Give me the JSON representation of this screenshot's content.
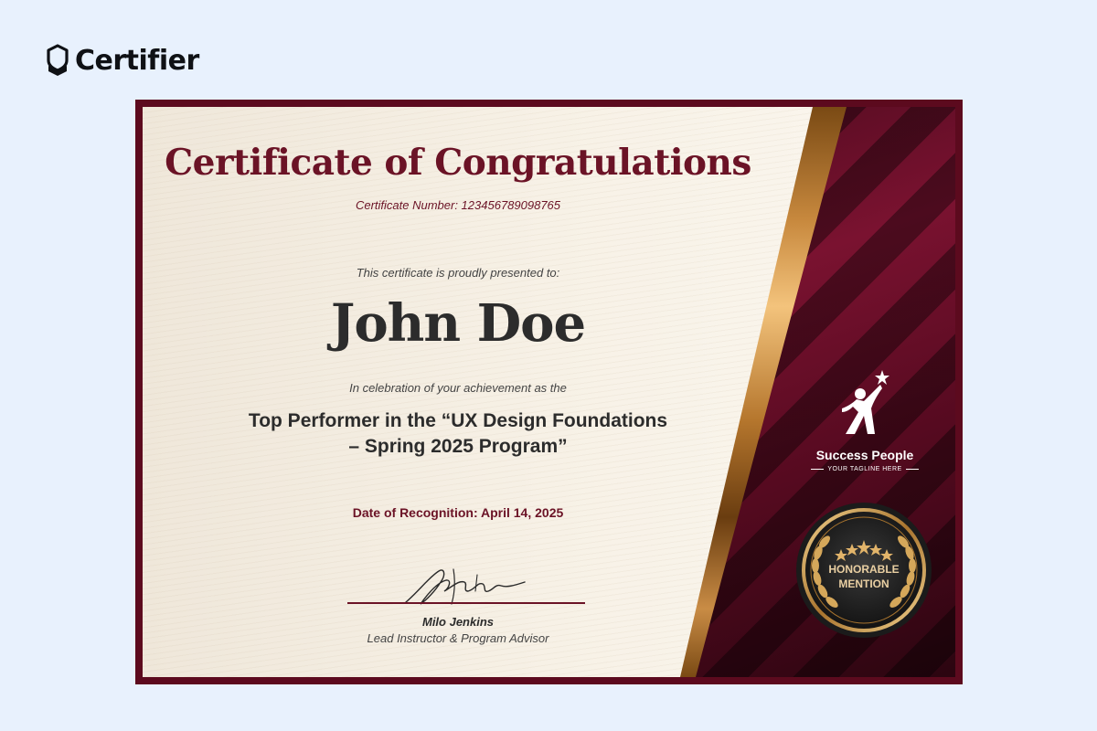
{
  "brand": {
    "name": "Certifier",
    "icon": "certifier-badge-icon"
  },
  "certificate": {
    "title": "Certificate of Congratulations",
    "number": "Certificate Number: 123456789098765",
    "presented": "This certificate is proudly presented to:",
    "recipient": "John Doe",
    "celebration": "In celebration of your achievement as the",
    "achievement_line1": "Top Performer in the “UX Design Foundations",
    "achievement_line2": "– Spring 2025 Program”",
    "date": "Date of Recognition: April 14, 2025",
    "signature_icon": "handwritten-signature",
    "signer_name": "Milo Jenkins",
    "signer_role": "Lead Instructor & Program Advisor"
  },
  "organization": {
    "name": "Success People",
    "tagline": "YOUR TAGLINE HERE",
    "icon": "star-person-icon"
  },
  "seal": {
    "line1": "HONORABLE",
    "line2": "MENTION",
    "icon": "laurel-stars-seal"
  },
  "colors": {
    "background": "#e8f1fd",
    "burgundy": "#6b1326",
    "gold": "#c8893e",
    "paper": "#f7f1e6"
  }
}
